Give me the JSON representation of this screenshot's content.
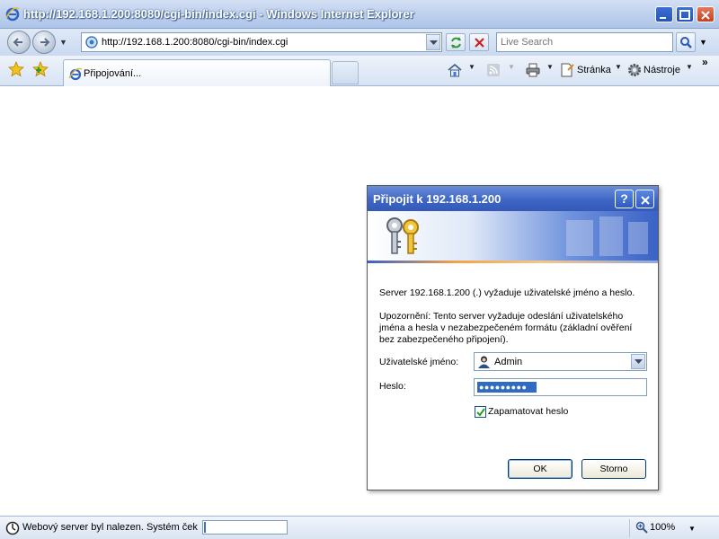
{
  "window": {
    "title": "http://192.168.1.200:8080/cgi-bin/index.cgi - Windows Internet Explorer"
  },
  "navbar": {
    "address_url": "http://192.168.1.200:8080/cgi-bin/index.cgi",
    "search_placeholder": "Live Search"
  },
  "tabbar": {
    "tab_label": "Připojování...",
    "page_label": "Stránka",
    "tools_label": "Nástroje",
    "chevron": "»"
  },
  "dialog": {
    "title": "Připojit k 192.168.1.200",
    "help_glyph": "?",
    "message": "Server 192.168.1.200 (.) vyžaduje uživatelské jméno a heslo.",
    "warning_line1": "Upozornění: Tento server vyžaduje odeslání uživatelského",
    "warning_line2": "jména a hesla v nezabezpečeném formátu (základní ověření",
    "warning_line3": "bez zabezpečeného připojení).",
    "username_label": "Uživatelské jméno:",
    "username_value": "Admin",
    "password_label": "Heslo:",
    "password_mask": "●●●●●●●●●",
    "remember_label": "Zapamatovat heslo",
    "remember_checked": true,
    "ok_label": "OK",
    "cancel_label": "Storno"
  },
  "statusbar": {
    "text": "Webový server byl nalezen. Systém čeká na odpověď...",
    "progress": 0.02,
    "zoom": "100%"
  },
  "colors": {
    "titlebar": "#aec4e8",
    "dialog_title": "#3f66c6",
    "selection": "#316ac5"
  }
}
